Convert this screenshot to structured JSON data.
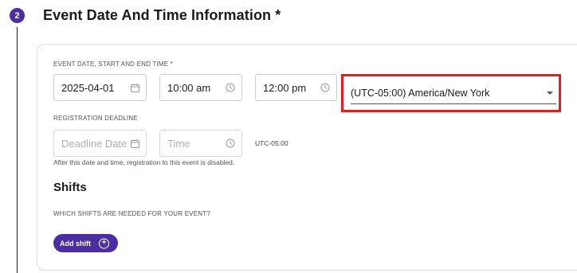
{
  "step": {
    "number": "2",
    "title": "Event Date And Time Information *"
  },
  "event_time": {
    "label": "EVENT DATE, START AND END TIME *",
    "date_value": "2025-04-01",
    "start_time_value": "10:00 am",
    "end_time_value": "12:00 pm",
    "timezone_value": "(UTC-05:00) America/New York"
  },
  "registration": {
    "label": "REGISTRATION DEADLINE",
    "date_placeholder": "Deadline Date",
    "time_placeholder": "Time",
    "timezone_note": "UTC-05:00",
    "helper": "After this date and time, registration to this event is disabled."
  },
  "shifts": {
    "title": "Shifts",
    "label": "WHICH SHIFTS ARE NEEDED FOR YOUR EVENT?",
    "add_button": "Add shift"
  },
  "colors": {
    "accent": "#4b2ea1",
    "highlight": "#e81c1c"
  },
  "icons": [
    "calendar-icon",
    "clock-icon",
    "dropdown-caret-icon",
    "plus-circle-icon"
  ]
}
